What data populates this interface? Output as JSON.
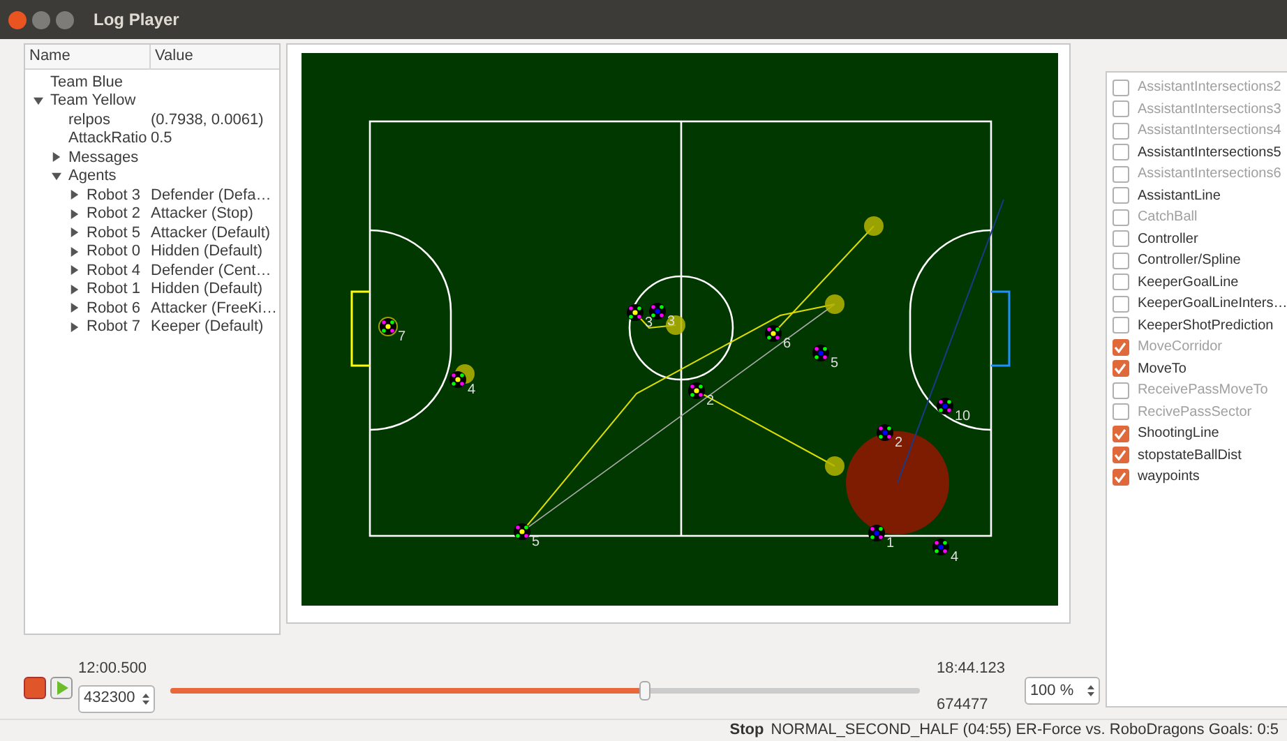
{
  "window": {
    "title": "Log Player"
  },
  "tree": {
    "columns": [
      "Name",
      "Value"
    ],
    "items": [
      {
        "name": "Team Blue"
      },
      {
        "name": "Team Yellow",
        "expanded": true,
        "children": [
          {
            "name": "relpos",
            "value": "(0.7938, 0.0061)"
          },
          {
            "name": "AttackRatio",
            "value": "0.5"
          },
          {
            "name": "Messages",
            "expanded": false
          },
          {
            "name": "Agents",
            "expanded": true,
            "children": [
              {
                "name": "Robot 3",
                "value": "Defender (Defa…",
                "expanded": false
              },
              {
                "name": "Robot 2",
                "value": "Attacker (Stop)",
                "expanded": false
              },
              {
                "name": "Robot 5",
                "value": "Attacker (Default)",
                "expanded": false
              },
              {
                "name": "Robot 0",
                "value": "Hidden (Default)",
                "expanded": false
              },
              {
                "name": "Robot 4",
                "value": "Defender (Cent…",
                "expanded": false
              },
              {
                "name": "Robot 1",
                "value": "Hidden (Default)",
                "expanded": false
              },
              {
                "name": "Robot 6",
                "value": "Attacker (FreeKi…",
                "expanded": false
              },
              {
                "name": "Robot 7",
                "value": "Keeper (Default)",
                "expanded": false
              }
            ]
          }
        ]
      }
    ]
  },
  "field": {
    "robots": [
      {
        "label": "7",
        "color": "#ffff00"
      },
      {
        "label": "4",
        "color": "#ffff00"
      },
      {
        "label": "3",
        "color": "#ffff00"
      },
      {
        "label": "6",
        "color": "#ffff00"
      },
      {
        "label": "2",
        "color": "#ffff00"
      },
      {
        "label": "5",
        "color": "#ffff00"
      },
      {
        "label": "3",
        "color": "#0000ff"
      },
      {
        "label": "5",
        "color": "#0000ff"
      },
      {
        "label": "10",
        "color": "#0000ff"
      },
      {
        "label": "2",
        "color": "#0000ff"
      },
      {
        "label": "1",
        "color": "#0000ff"
      },
      {
        "label": "4",
        "color": "#0000ff"
      }
    ]
  },
  "visualizations": [
    {
      "label": "AssistantIntersections2",
      "checked": false,
      "active": false
    },
    {
      "label": "AssistantIntersections3",
      "checked": false,
      "active": false
    },
    {
      "label": "AssistantIntersections4",
      "checked": false,
      "active": false
    },
    {
      "label": "AssistantIntersections5",
      "checked": false,
      "active": true
    },
    {
      "label": "AssistantIntersections6",
      "checked": false,
      "active": false
    },
    {
      "label": "AssistantLine",
      "checked": false,
      "active": true
    },
    {
      "label": "CatchBall",
      "checked": false,
      "active": false
    },
    {
      "label": "Controller",
      "checked": false,
      "active": true
    },
    {
      "label": "Controller/Spline",
      "checked": false,
      "active": true
    },
    {
      "label": "KeeperGoalLine",
      "checked": false,
      "active": true
    },
    {
      "label": "KeeperGoalLineInters…",
      "checked": false,
      "active": true
    },
    {
      "label": "KeeperShotPrediction",
      "checked": false,
      "active": true
    },
    {
      "label": "MoveCorridor",
      "checked": true,
      "active": false
    },
    {
      "label": "MoveTo",
      "checked": true,
      "active": true
    },
    {
      "label": "ReceivePassMoveTo",
      "checked": false,
      "active": false
    },
    {
      "label": "RecivePassSector",
      "checked": false,
      "active": false
    },
    {
      "label": "ShootingLine",
      "checked": true,
      "active": true
    },
    {
      "label": "stopstateBallDist",
      "checked": true,
      "active": true
    },
    {
      "label": "waypoints",
      "checked": true,
      "active": true
    }
  ],
  "playback": {
    "start_time": "12:00.500",
    "frame": "432300",
    "end_time": "18:44.123",
    "end_frame": "674477",
    "level": 0.634,
    "speed": "100 %"
  },
  "status_bar": {
    "state": "Stop",
    "text": "NORMAL_SECOND_HALF (04:55) ER-Force vs. RoboDragons Goals: 0:5"
  }
}
